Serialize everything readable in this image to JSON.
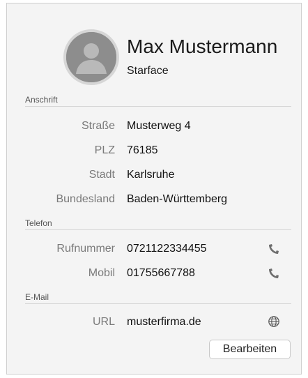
{
  "contact": {
    "name": "Max Mustermann",
    "company": "Starface"
  },
  "sections": {
    "address": "Anschrift",
    "phone": "Telefon",
    "email": "E-Mail"
  },
  "address": {
    "street_label": "Straße",
    "street_value": "Musterweg 4",
    "zip_label": "PLZ",
    "zip_value": "76185",
    "city_label": "Stadt",
    "city_value": "Karlsruhe",
    "state_label": "Bundesland",
    "state_value": "Baden-Württemberg"
  },
  "phone": {
    "number_label": "Rufnummer",
    "number_value": "0721122334455",
    "mobile_label": "Mobil",
    "mobile_value": "01755667788"
  },
  "web": {
    "url_label": "URL",
    "url_value": "musterfirma.de"
  },
  "actions": {
    "edit_label": "Bearbeiten"
  },
  "icons": {
    "avatar": "person-silhouette-icon",
    "call": "phone-handset-icon",
    "web": "globe-icon"
  },
  "colors": {
    "panel_background": "#f4f4f4",
    "avatar_fill": "#8d8d8d",
    "label_text": "#7a7a7a"
  }
}
